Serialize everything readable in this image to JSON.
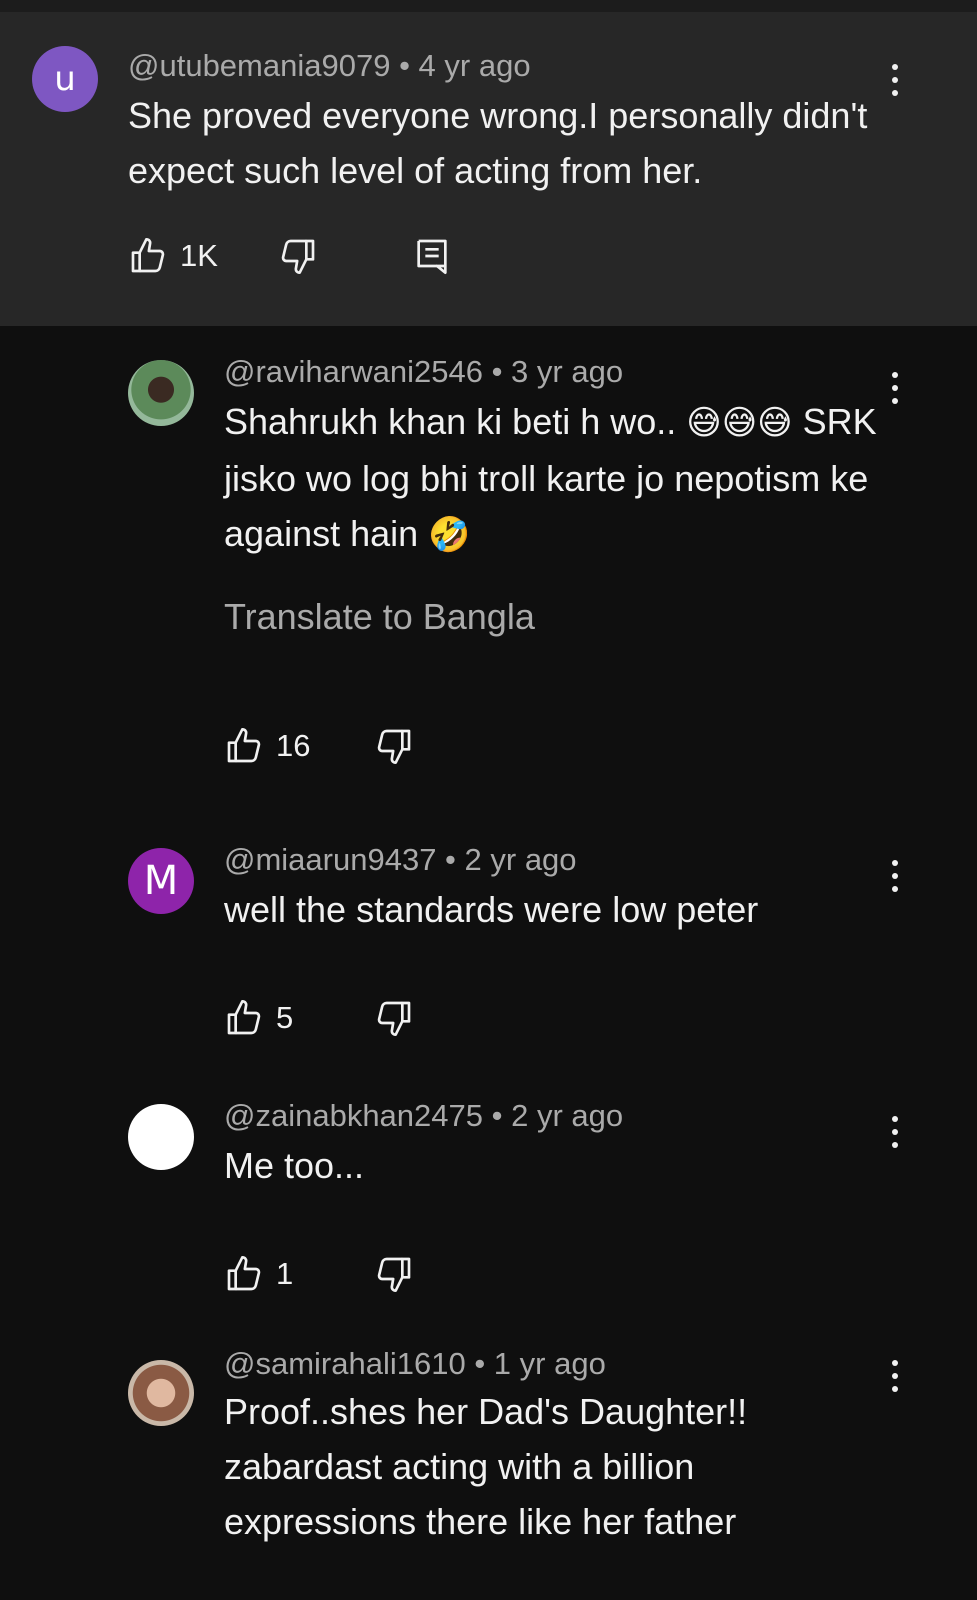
{
  "comments": [
    {
      "handle": "@utubemania9079",
      "sep": " • ",
      "age": "4 yr ago",
      "avatar_letter": "u",
      "avatar_color": "#7e57c2",
      "text": "She proved everyone wrong.I personally didn't expect such level of acting from her.",
      "likes": "1K"
    },
    {
      "handle": "@raviharwani2546",
      "sep": " • ",
      "age": "3 yr ago",
      "avatar_letter": "",
      "avatar_color": "#6a8f78",
      "text_line1": "Shahrukh khan ki beti h wo.. ",
      "emoji1": "😅😅😅",
      "text_line2": "SRK jisko wo log bhi troll karte jo nepotism ke against hain ",
      "emoji2": "🤣",
      "translate": "Translate to Bangla",
      "likes": "16"
    },
    {
      "handle": "@miaarun9437",
      "sep": " • ",
      "age": "2 yr ago",
      "avatar_letter": "M",
      "avatar_color": "#8e24aa",
      "text": "well the standards were low peter",
      "likes": "5"
    },
    {
      "handle": "@zainabkhan2475",
      "sep": " • ",
      "age": "2 yr ago",
      "avatar_letter": "",
      "avatar_color": "#ffffff",
      "text": "Me too...",
      "likes": "1"
    },
    {
      "handle": "@samirahali1610",
      "sep": " • ",
      "age": "1 yr ago",
      "avatar_letter": "",
      "avatar_color": "#b08878",
      "text": "Proof..shes her Dad's Daughter!! zabardast acting with a billion expressions there like her father"
    }
  ],
  "icons": {
    "like": "thumbs-up-icon",
    "dislike": "thumbs-down-icon",
    "reply": "reply-icon",
    "more": "more-vertical-icon"
  }
}
